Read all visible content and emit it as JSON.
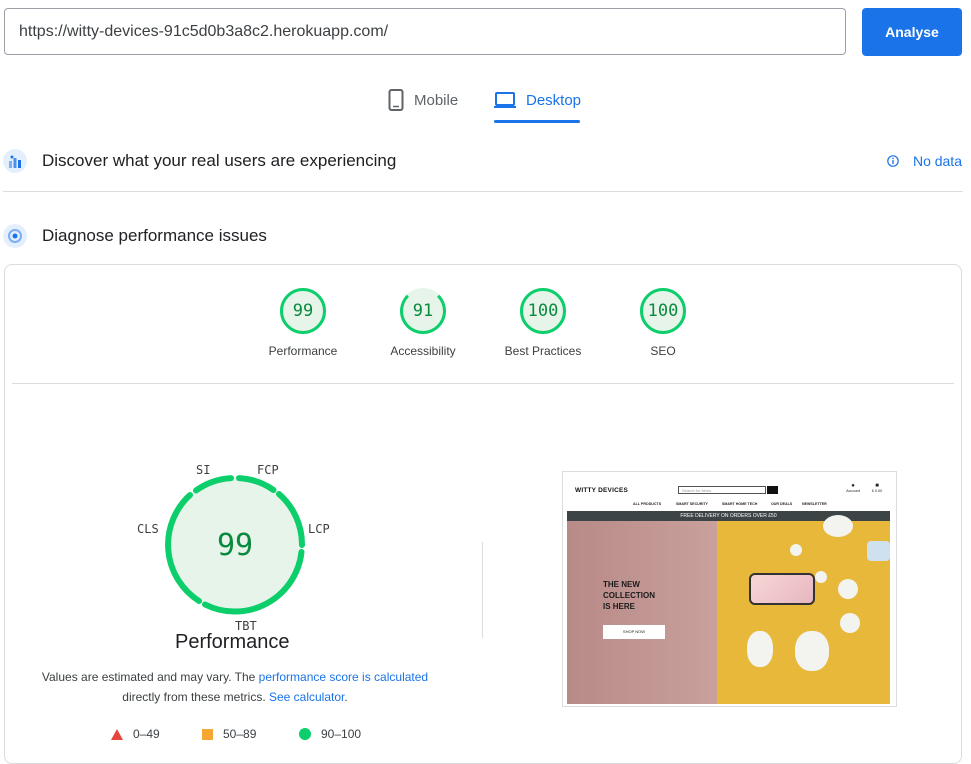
{
  "search": {
    "url": "https://witty-devices-91c5d0b3a8c2.herokuapp.com/",
    "analyse_label": "Analyse"
  },
  "device_tabs": {
    "mobile": "Mobile",
    "desktop": "Desktop",
    "selected": "Desktop"
  },
  "field_data": {
    "title": "Discover what your real users are experiencing",
    "status": "No data"
  },
  "lab_data": {
    "title": "Diagnose performance issues"
  },
  "category_scores": [
    {
      "label": "Performance",
      "score": "99"
    },
    {
      "label": "Accessibility",
      "score": "91"
    },
    {
      "label": "Best Practices",
      "score": "100"
    },
    {
      "label": "SEO",
      "score": "100"
    }
  ],
  "performance_gauge": {
    "score": "99",
    "title": "Performance",
    "metric_labels": {
      "si": "SI",
      "fcp": "FCP",
      "lcp": "LCP",
      "tbt": "TBT",
      "cls": "CLS"
    }
  },
  "note": {
    "text1": "Values are estimated and may vary. The ",
    "link1": "performance score is calculated",
    "text2": "directly from these metrics. ",
    "link2": "See calculator",
    "text3": "."
  },
  "legend": [
    {
      "range": "0–49",
      "color": "#e8453c",
      "shape": "triangle"
    },
    {
      "range": "50–89",
      "color": "#f4a833",
      "shape": "square"
    },
    {
      "range": "90–100",
      "color": "#0cce6b",
      "shape": "circle"
    }
  ],
  "screenshot_preview": {
    "logo": "WITTY DEVICES",
    "search_placeholder": "Search for items",
    "nav": [
      "ALL PRODUCTS",
      "SMART SECURITY",
      "SMART HOME TECH",
      "OUR DEALS",
      "NEWSLETTER"
    ],
    "account": "Account",
    "basket": "£ 0.00",
    "banner": "FREE DELIVERY ON ORDERS OVER £50",
    "hero_lines": [
      "THE NEW",
      "COLLECTION",
      "IS HERE"
    ],
    "cta": "SHOP NOW"
  },
  "colors": {
    "accent": "#1a73e8",
    "pass": "#0cce6b",
    "pass_bg": "#e6f4ea",
    "pass_text": "#0a8a3e"
  }
}
